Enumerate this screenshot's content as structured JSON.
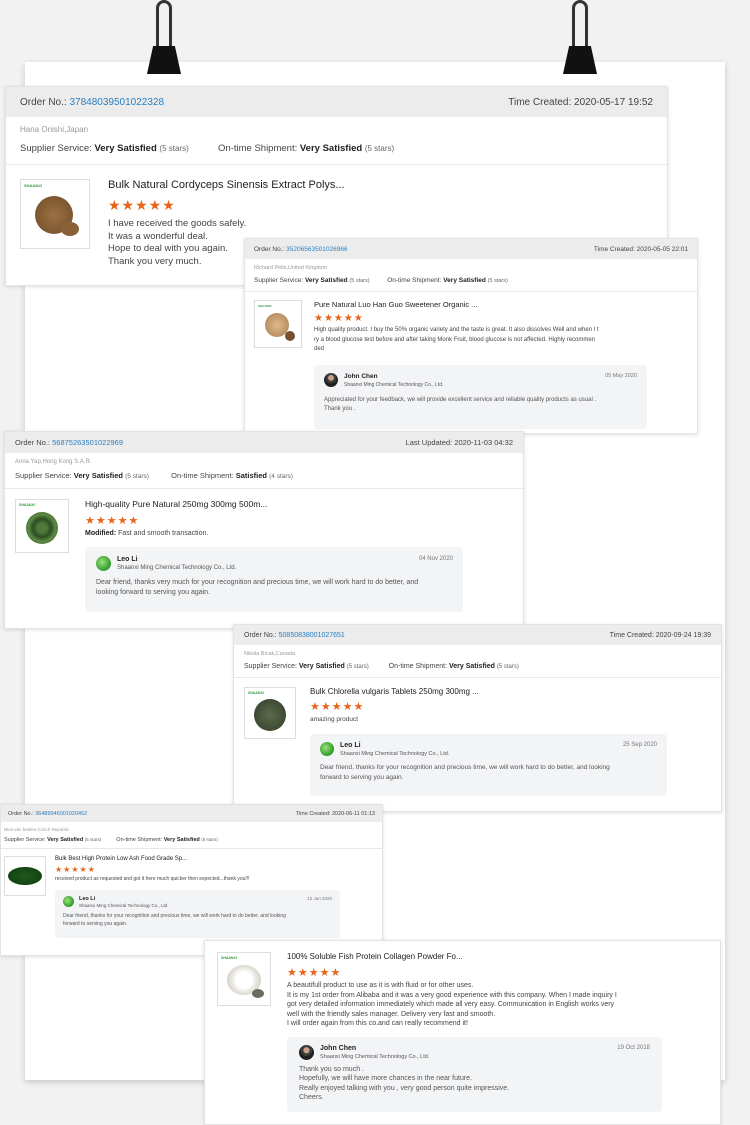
{
  "cards": [
    {
      "order_label": "Order No.:",
      "order_no": "37848039501022328",
      "time_label": "Time Created:",
      "time": "2020-05-17 19:52",
      "buyer": "Hana Onishi,Japan",
      "supplier_label": "Supplier Service:",
      "supplier_value": "Very Satisfied",
      "supplier_stars": "(5 stars)",
      "shipment_label": "On-time Shipment:",
      "shipment_value": "Very Satisfied",
      "shipment_stars": "(5 stars)",
      "product": "Bulk Natural Cordyceps Sinensis Extract Polys...",
      "rating": 5,
      "review": [
        "I have received the goods safely.",
        "It was a wonderful deal.",
        "Hope to deal with you again.",
        "Thank you very much."
      ]
    },
    {
      "order_label": "Order No.:",
      "order_no": "35206563501026966",
      "time_label": "Time Created:",
      "time": "2020-05-05 22:01",
      "buyer": "Richard Pells,United Kingdom",
      "supplier_label": "Supplier Service:",
      "supplier_value": "Very Satisfied",
      "supplier_stars": "(5 stars)",
      "shipment_label": "On-time Shipment:",
      "shipment_value": "Very Satisfied",
      "shipment_stars": "(5 stars)",
      "product": "Pure Natural Luo Han Guo Sweetener Organic ...",
      "rating": 5,
      "review": [
        "High quality product. I buy the 50% organic variety and the taste is great. It also dissolves Well and when I t",
        "ry a blood glucose test before and after taking Monk Fruit, blood glucose is not affected. Highly recommen",
        "ded"
      ],
      "reply": {
        "name": "John Chen",
        "company": "Shaanxi Ming Chemical Technology Co., Ltd.",
        "date": "05 May 2020",
        "text": [
          "Appreciated for your feedback, we will provide excellent service and reliable quality products as usual .",
          "Thank you ."
        ]
      }
    },
    {
      "order_label": "Order No.:",
      "order_no": "56875263501022969",
      "time_label": "Last Updated:",
      "time": "2020-11-03 04:32",
      "buyer": "Anna Yap,Hong Kong S.A.R.",
      "supplier_label": "Supplier Service:",
      "supplier_value": "Very Satisfied",
      "supplier_stars": "(5 stars)",
      "shipment_label": "On-time Shipment:",
      "shipment_value": "Satisfied",
      "shipment_stars": "(4 stars)",
      "product": "High-quality Pure Natural 250mg 300mg 500m...",
      "rating": 5,
      "modified_label": "Modified:",
      "review": [
        "Fast and smooth transaction."
      ],
      "reply": {
        "name": "Leo Li",
        "company": "Shaanxi Ming Chemical Technology Co., Ltd.",
        "date": "04 Nov 2020",
        "text": [
          "Dear friend, thanks very much for your recognition and precious time, we will work hard to do better, and",
          "looking forward to serving you again."
        ]
      }
    },
    {
      "order_label": "Order No.:",
      "order_no": "50850838001027651",
      "time_label": "Time Created:",
      "time": "2020-09-24 19:39",
      "buyer": "Nikola Bicak,Canada",
      "supplier_label": "Supplier Service:",
      "supplier_value": "Very Satisfied",
      "supplier_stars": "(5 stars)",
      "shipment_label": "On-time Shipment:",
      "shipment_value": "Very Satisfied",
      "shipment_stars": "(5 stars)",
      "product": "Bulk Chlorella vulgaris Tablets 250mg 300mg ...",
      "rating": 5,
      "review": [
        "amazing product"
      ],
      "reply": {
        "name": "Leo Li",
        "company": "Shaanxi Ming Chemical Technology Co., Ltd.",
        "date": "25 Sep 2020",
        "text": [
          "Dear friend, thanks for your recognition and precious time, we will work hard to do better, and looking",
          "forward to serving you again."
        ]
      }
    },
    {
      "order_label": "Order No.:",
      "order_no": "36489946001020452",
      "time_label": "Time Created:",
      "time": "2020-06-11 01:13",
      "buyer": "Nice van beelen,Czech Republic",
      "supplier_label": "Supplier Service:",
      "supplier_value": "Very Satisfied",
      "supplier_stars": "(5 stars)",
      "shipment_label": "On-time Shipment:",
      "shipment_value": "Very Satisfied",
      "shipment_stars": "(5 stars)",
      "product": "Bulk Best High Protein Low Ash Food Grade Sp...",
      "rating": 5,
      "review": [
        "received product as requested and got it here much quicker then expected...thank you!!!"
      ],
      "reply": {
        "name": "Leo Li",
        "company": "Shaanxi Ming Chemical Technology Co., Ltd.",
        "date": "12 Jun 2020",
        "text": [
          "Dear friend, thanks for your recognition and precious time, we will work hard to do better, and looking",
          "forward to serving you again."
        ]
      }
    },
    {
      "product": "100% Soluble Fish Protein Collagen Powder Fo...",
      "rating": 5,
      "review": [
        "A beautifull product to use as it is with fluid or for other uses.",
        "It is my 1st order from Alibaba and it was a very good experience with this company. When I made inquiry I",
        "got very detailed information immediately which made all very easy. Communication in English works very",
        "well with the friendly sales manager. Delivery very fast and smooth.",
        "I will order again from this co.and can really recommend it!"
      ],
      "reply": {
        "name": "John Chen",
        "company": "Shaanxi Ming Chemical Technology Co., Ltd.",
        "date": "19 Oct 2018",
        "text": [
          "Thank you so much .",
          "Hopefully, we will have more chances in the near future.",
          "Really enjoyed talking with you , very good person quite impressive.",
          "Cheers."
        ]
      }
    }
  ],
  "stars_glyph": "★★★★★",
  "thumb_logo": "SHAANXI",
  "colors": {
    "link": "#2a7fc0",
    "stars": "#e8641a",
    "header_bg": "#ececec"
  }
}
